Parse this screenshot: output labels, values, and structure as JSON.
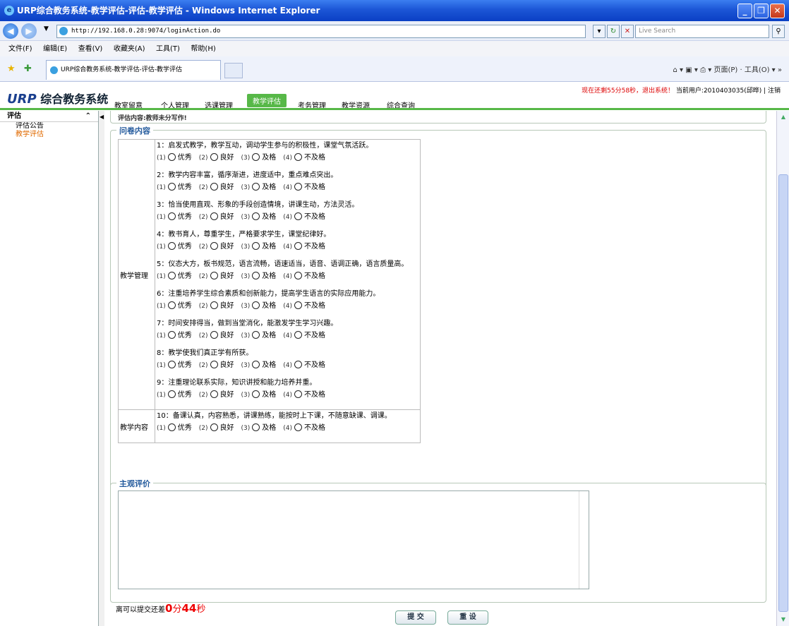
{
  "window": {
    "title": "URP综合教务系统-教学评估-评估-教学评估 - Windows Internet Explorer"
  },
  "address": {
    "url": "http://192.168.0.28:9074/loginAction.do",
    "search_placeholder": "Live Search"
  },
  "menu": [
    "文件(F)",
    "编辑(E)",
    "查看(V)",
    "收藏夹(A)",
    "工具(T)",
    "帮助(H)"
  ],
  "ie_tab": {
    "title": "URP综合教务系统-教学评估-评估-教学评估"
  },
  "ie_tools": "页面(P) · 工具(O)",
  "header": {
    "logo_urp": "URP",
    "logo_text": "综合教务系统",
    "status_timer": "现在还剩55分58秒，退出系统！",
    "status_user": "当前用户:2010403035(邱晔) | 注销",
    "nav": [
      "教室留意",
      "个人管理",
      "选课管理",
      "教学评估",
      "考务管理",
      "教学资源",
      "综合查询"
    ]
  },
  "sidebar": {
    "title": "评估",
    "items": [
      "评估公告",
      "教学评估"
    ]
  },
  "eval": {
    "top_text": "评估内容:教师未分写作!",
    "questionnaire_legend": "问卷内容",
    "categories": [
      "教学管理",
      "教学内容"
    ],
    "options": [
      {
        "num": "(1)",
        "label": "优秀"
      },
      {
        "num": "(2)",
        "label": "良好"
      },
      {
        "num": "(3)",
        "label": "及格"
      },
      {
        "num": "(4)",
        "label": "不及格"
      }
    ],
    "questions": [
      "1：启发式教学，教学互动，调动学生参与的积极性，课堂气氛活跃。",
      "2：教学内容丰富，循序渐进，进度适中，重点难点突出。",
      "3：恰当使用直观、形象的手段创造情境，讲课生动，方法灵活。",
      "4：教书育人，尊重学生，严格要求学生，课堂纪律好。",
      "5：仪态大方，板书规范，语言流畅，语速适当，语音、语调正确，语言质量高。",
      "6：注重培养学生综合素质和创新能力，提高学生语言的实际应用能力。",
      "7：时间安排得当，做到当堂消化，能激发学生学习兴趣。",
      "8：教学使我们真正学有所获。",
      "9：注重理论联系实际，知识讲授和能力培养并重。",
      "10：备课认真，内容熟悉，讲课熟练，能按时上下课，不随意缺课、调课。"
    ],
    "subjective_legend": "主观评价",
    "comment_value": "",
    "countdown_prefix": "离可以提交还差",
    "countdown_min": "0",
    "countdown_min_unit": "分",
    "countdown_sec": "44",
    "countdown_sec_unit": "秒",
    "submit_label": "提 交",
    "reset_label": "重 设"
  }
}
